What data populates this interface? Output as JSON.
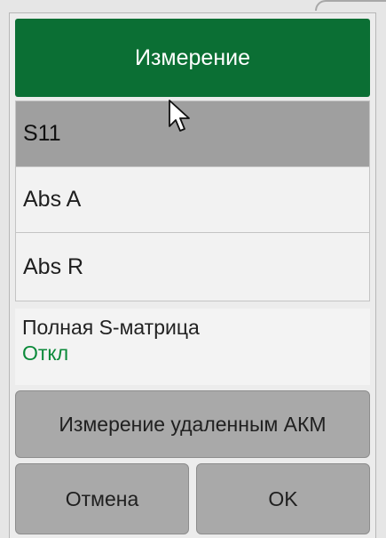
{
  "dialog": {
    "title": "Измерение"
  },
  "measurements": [
    {
      "label": "S11",
      "selected": true
    },
    {
      "label": "Abs A",
      "selected": false
    },
    {
      "label": "Abs R",
      "selected": false
    }
  ],
  "full_s_matrix": {
    "label": "Полная S-матрица",
    "value": "Откл"
  },
  "buttons": {
    "remote_label": "Измерение удаленным АКМ",
    "cancel_label": "Отмена",
    "ok_label": "OK"
  },
  "colors": {
    "header_bg": "#0b6f34",
    "selected_bg": "#9f9f9f",
    "value_text": "#0b8a3a",
    "button_bg": "#a9a9a9"
  },
  "icons": {
    "pointer": "mouse-pointer-icon"
  }
}
